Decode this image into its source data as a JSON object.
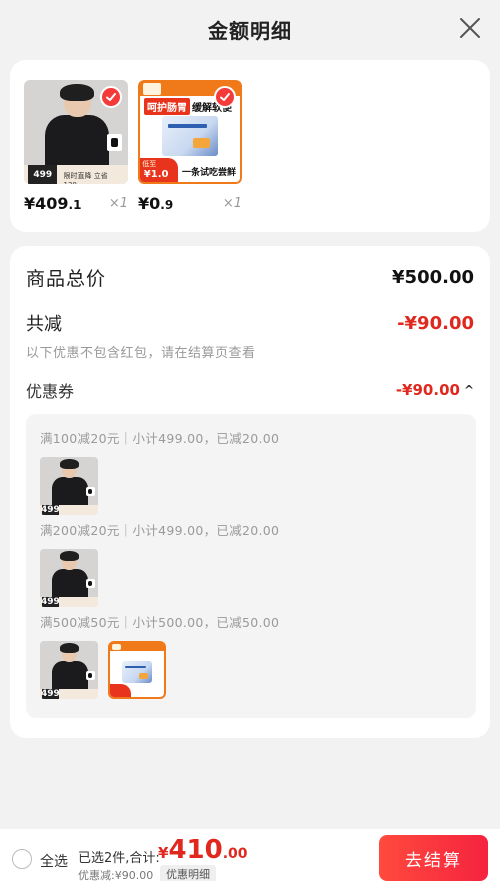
{
  "header": {
    "title": "金额明细"
  },
  "products": [
    {
      "name": "jacket",
      "price_int": "¥409",
      "price_dec": ".1",
      "qty": "×1",
      "img_price": "499",
      "img_tag": "限时直降 立省 130"
    },
    {
      "name": "probiotic",
      "price_int": "¥0",
      "price_dec": ".9",
      "qty": "×1",
      "headline_red": "呵护肠胃",
      "headline_black": "缓解软便",
      "tag_label": "低至",
      "tag_value": "¥1.0",
      "slogan": "一条试吃尝鲜"
    }
  ],
  "summary": {
    "total_label": "商品总价",
    "total_value": "¥500.00",
    "reduce_label": "共减",
    "reduce_value": "-¥90.00",
    "note": "以下优惠不包含红包，请在结算页查看",
    "coupon_label": "优惠券",
    "coupon_value": "-¥90.00",
    "coupon_chevron": "^"
  },
  "coupon_groups": [
    {
      "line": "满100减20元｜小计499.00，已减20.00",
      "items": [
        "jacket"
      ]
    },
    {
      "line": "满200减20元｜小计499.00，已减20.00",
      "items": [
        "jacket"
      ]
    },
    {
      "line": "满500减50元｜小计500.00，已减50.00",
      "items": [
        "jacket",
        "probiotic"
      ]
    }
  ],
  "footer": {
    "select_all": "全选",
    "selected_info": "已选2件,合计:",
    "sum_currency": "¥",
    "sum_int": "410",
    "sum_dec": ".00",
    "discount": "优惠减:¥90.00",
    "detail_button": "优惠明细",
    "checkout_button": "去结算"
  },
  "colors": {
    "accent": "#e0281e",
    "checkout_start": "#ff4a3d",
    "checkout_end": "#f5233f"
  }
}
